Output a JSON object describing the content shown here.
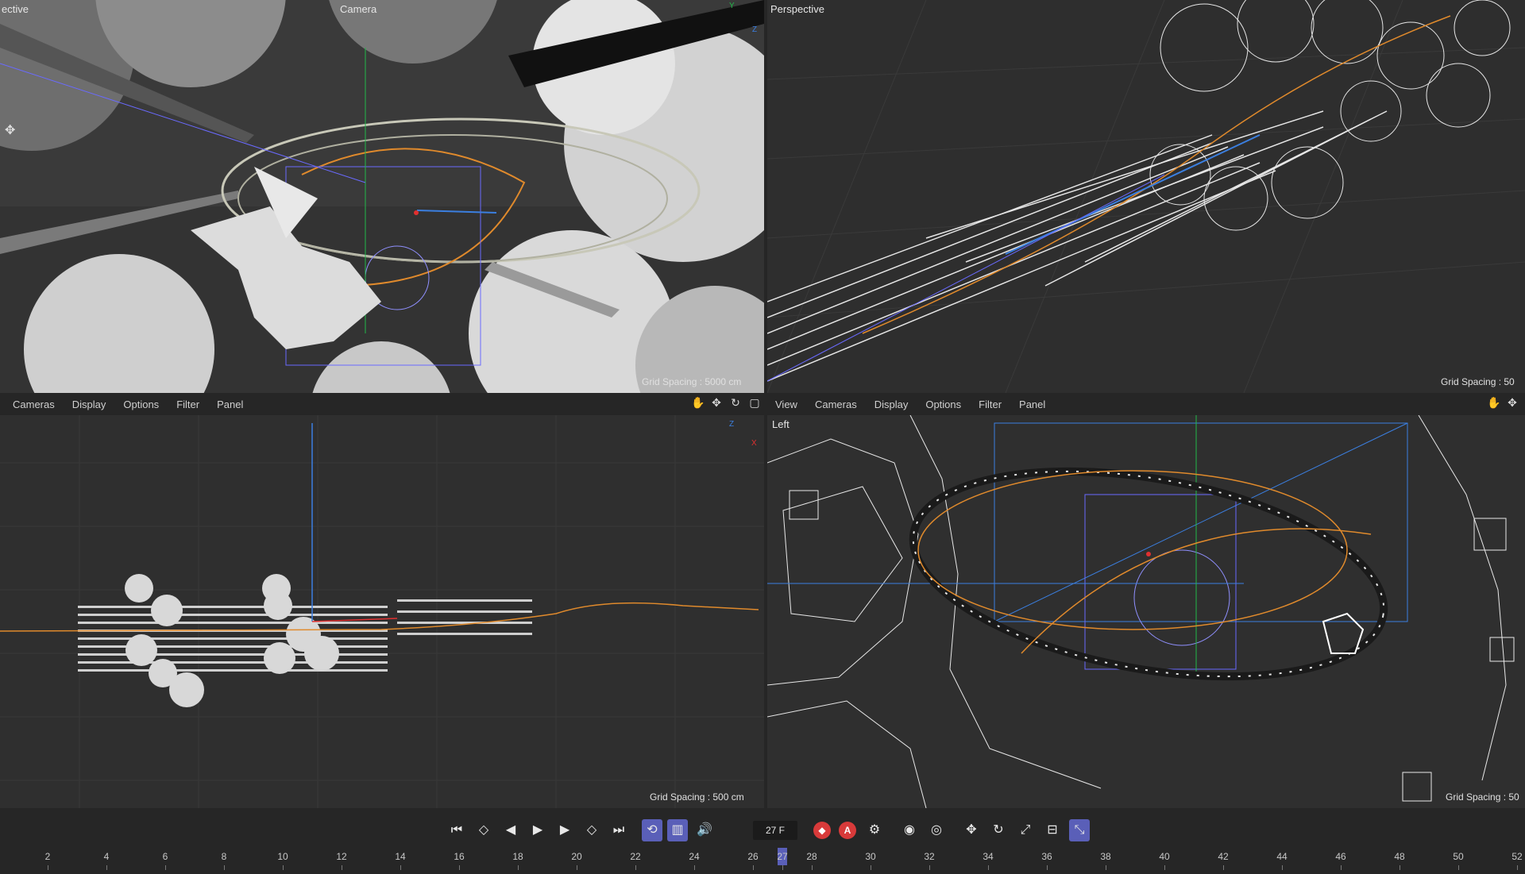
{
  "viewports": {
    "top_left": {
      "label": "ective",
      "camera_label": "Camera",
      "grid_spacing": "Grid Spacing : 5000 cm"
    },
    "top_right": {
      "label": "Perspective",
      "grid_spacing": "Grid Spacing : 50"
    },
    "bottom_left": {
      "menu": [
        "Cameras",
        "Display",
        "Options",
        "Filter",
        "Panel"
      ],
      "grid_spacing": "Grid Spacing : 500 cm"
    },
    "bottom_right": {
      "label": "Left",
      "menu": [
        "View",
        "Cameras",
        "Display",
        "Options",
        "Filter",
        "Panel"
      ],
      "grid_spacing": "Grid Spacing : 50"
    }
  },
  "axes": {
    "y": "Y",
    "z": "Z",
    "x": "X"
  },
  "timeline": {
    "current_frame": "27 F",
    "record_label": "A",
    "ticks": [
      "2",
      "4",
      "6",
      "8",
      "10",
      "12",
      "14",
      "16",
      "18",
      "20",
      "22",
      "24",
      "26",
      "27",
      "28",
      "30",
      "32",
      "34",
      "36",
      "38",
      "40",
      "42",
      "44",
      "46",
      "48",
      "50",
      "52"
    ]
  },
  "icons": {
    "transport": [
      "go-to-start-icon",
      "previous-key-icon",
      "step-back-icon",
      "play-icon",
      "step-forward-icon",
      "next-key-icon",
      "go-to-end-icon"
    ],
    "colors": {
      "accent": "#5a5fb8",
      "record": "#d83a3a",
      "spline": "#e08a2c",
      "axis_blue": "#3b7fe0",
      "axis_green": "#22b84a"
    }
  }
}
